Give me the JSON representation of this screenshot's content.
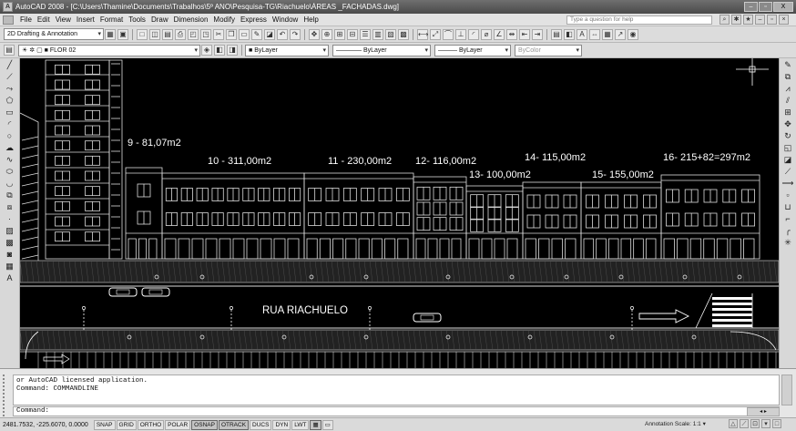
{
  "window": {
    "title": "AutoCAD 2008 - [C:\\Users\\Thamine\\Documents\\Trabalhos\\5º ANO\\Pesquisa-TG\\Riachuelo\\ÁREAS _FACHADAS.dwg]",
    "minimize": "–",
    "restore": "▫",
    "close": "X"
  },
  "menu": {
    "items": [
      "File",
      "Edit",
      "View",
      "Insert",
      "Format",
      "Tools",
      "Draw",
      "Dimension",
      "Modify",
      "Express",
      "Window",
      "Help"
    ],
    "help_placeholder": "Type a question for help"
  },
  "toolbar1": {
    "workspace": "2D Drafting & Annotation"
  },
  "toolbar2": {
    "layer": "FLOR 02",
    "color": "ByLayer",
    "linetype": "ByLayer",
    "lineweight": "ByLayer",
    "plotstyle": "ByColor"
  },
  "drawing": {
    "street_name": "RUA RIACHUELO",
    "areas": [
      {
        "label": "9 - 81,07m2"
      },
      {
        "label": "10 - 311,00m2"
      },
      {
        "label": "11 - 230,00m2"
      },
      {
        "label": "12- 116,00m2"
      },
      {
        "label": "13- 100,00m2"
      },
      {
        "label": "14- 115,00m2"
      },
      {
        "label": "15- 155,00m2"
      },
      {
        "label": "16- 215+82=297m2"
      }
    ]
  },
  "command": {
    "history": [
      "or AutoCAD licensed application.",
      "Command: COMMANDLINE"
    ],
    "prompt": "Command:"
  },
  "status": {
    "coordinates": "2481.7532, -225.6070, 0.0000",
    "toggles": [
      {
        "label": "SNAP",
        "on": false
      },
      {
        "label": "GRID",
        "on": false
      },
      {
        "label": "ORTHO",
        "on": false
      },
      {
        "label": "POLAR",
        "on": false
      },
      {
        "label": "OSNAP",
        "on": true
      },
      {
        "label": "OTRACK",
        "on": true
      },
      {
        "label": "DUCS",
        "on": false
      },
      {
        "label": "DYN",
        "on": false
      },
      {
        "label": "LWT",
        "on": false
      }
    ],
    "annotation_scale": "Annotation Scale: 1:1 ▾"
  }
}
